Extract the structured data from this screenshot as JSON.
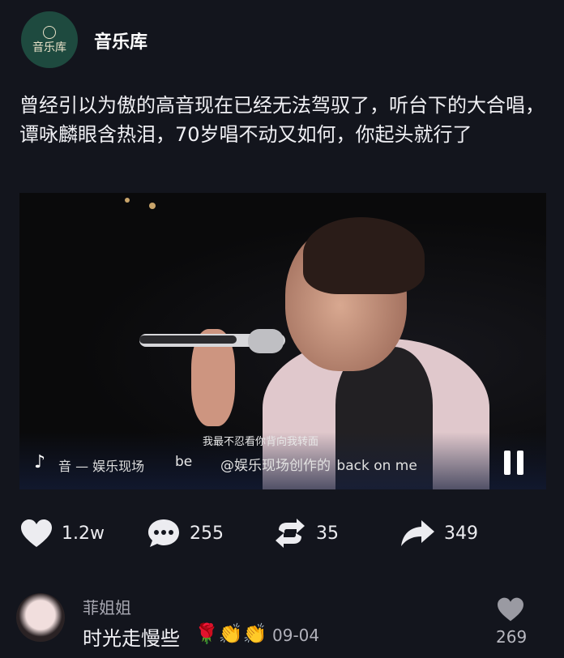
{
  "account": {
    "avatar_text": "音乐库",
    "name": "音乐库"
  },
  "post": {
    "text": "曾经引以为傲的高音现在已经无法驾驭了，听台下的大合唱，谭咏麟眼含热泪，70岁唱不动又如何，你起头就行了"
  },
  "video": {
    "subtitle_cn": "我最不忍看你背向我转面",
    "subtitle_en": "be",
    "subtitle_en_tail": "back on me",
    "watermark_left": "音 — 娱乐现场",
    "watermark_right": "@娱乐现场创作的"
  },
  "actions": {
    "like": {
      "icon": "heart-icon",
      "count": "1.2w"
    },
    "comment": {
      "icon": "comment-icon",
      "count": "255"
    },
    "repost": {
      "icon": "repost-icon",
      "count": "35"
    },
    "share": {
      "icon": "share-icon",
      "count": "349"
    }
  },
  "comment": {
    "username": "菲姐姐",
    "text": "时光走慢些",
    "emojis": "🌹👏👏",
    "date": "09-04",
    "like_count": "269"
  }
}
